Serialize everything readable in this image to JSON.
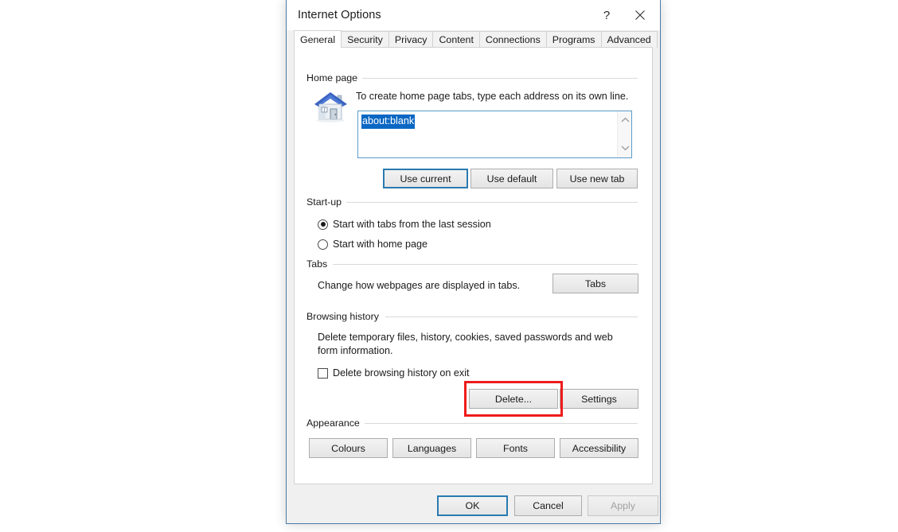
{
  "window": {
    "title": "Internet Options",
    "help_icon": "question-mark-icon",
    "help_glyph": "?",
    "close_icon": "close-icon"
  },
  "tabs": [
    {
      "label": "General",
      "active": true
    },
    {
      "label": "Security",
      "active": false
    },
    {
      "label": "Privacy",
      "active": false
    },
    {
      "label": "Content",
      "active": false
    },
    {
      "label": "Connections",
      "active": false
    },
    {
      "label": "Programs",
      "active": false
    },
    {
      "label": "Advanced",
      "active": false
    }
  ],
  "home_page": {
    "group_label": "Home page",
    "icon": "house-icon",
    "description": "To create home page tabs, type each address on its own line.",
    "value": "about:blank",
    "selected": true,
    "scroll_up_icon": "chevron-up-icon",
    "scroll_down_icon": "chevron-down-icon",
    "buttons": [
      {
        "label": "Use current",
        "focused": true
      },
      {
        "label": "Use default",
        "focused": false
      },
      {
        "label": "Use new tab",
        "focused": false
      }
    ]
  },
  "startup": {
    "group_label": "Start-up",
    "options": [
      {
        "label": "Start with tabs from the last session",
        "checked": true
      },
      {
        "label": "Start with home page",
        "checked": false
      }
    ]
  },
  "tabs_section": {
    "group_label": "Tabs",
    "description": "Change how webpages are displayed in tabs.",
    "button_label": "Tabs"
  },
  "browsing_history": {
    "group_label": "Browsing history",
    "description_line1": "Delete temporary files, history, cookies, saved passwords and web",
    "description_line2": "form information.",
    "checkbox_label": "Delete browsing history on exit",
    "checkbox_checked": false,
    "delete_button": "Delete...",
    "settings_button": "Settings",
    "highlight_color": "#ee1c1c",
    "highlight_target": "Delete..."
  },
  "appearance": {
    "group_label": "Appearance",
    "buttons": [
      {
        "label": "Colours"
      },
      {
        "label": "Languages"
      },
      {
        "label": "Fonts"
      },
      {
        "label": "Accessibility"
      }
    ]
  },
  "footer": {
    "ok": "OK",
    "cancel": "Cancel",
    "apply": "Apply",
    "apply_disabled": true,
    "ok_default": true
  },
  "colors": {
    "dialog_border": "#4a7ba6",
    "dialog_background": "#f0f0f0",
    "panel_background": "#ffffff",
    "focus_border": "#2a7ab0",
    "selection_background": "#0b67c4",
    "highlight_red": "#ee1c1c",
    "disabled_text": "#a2a2a2"
  }
}
